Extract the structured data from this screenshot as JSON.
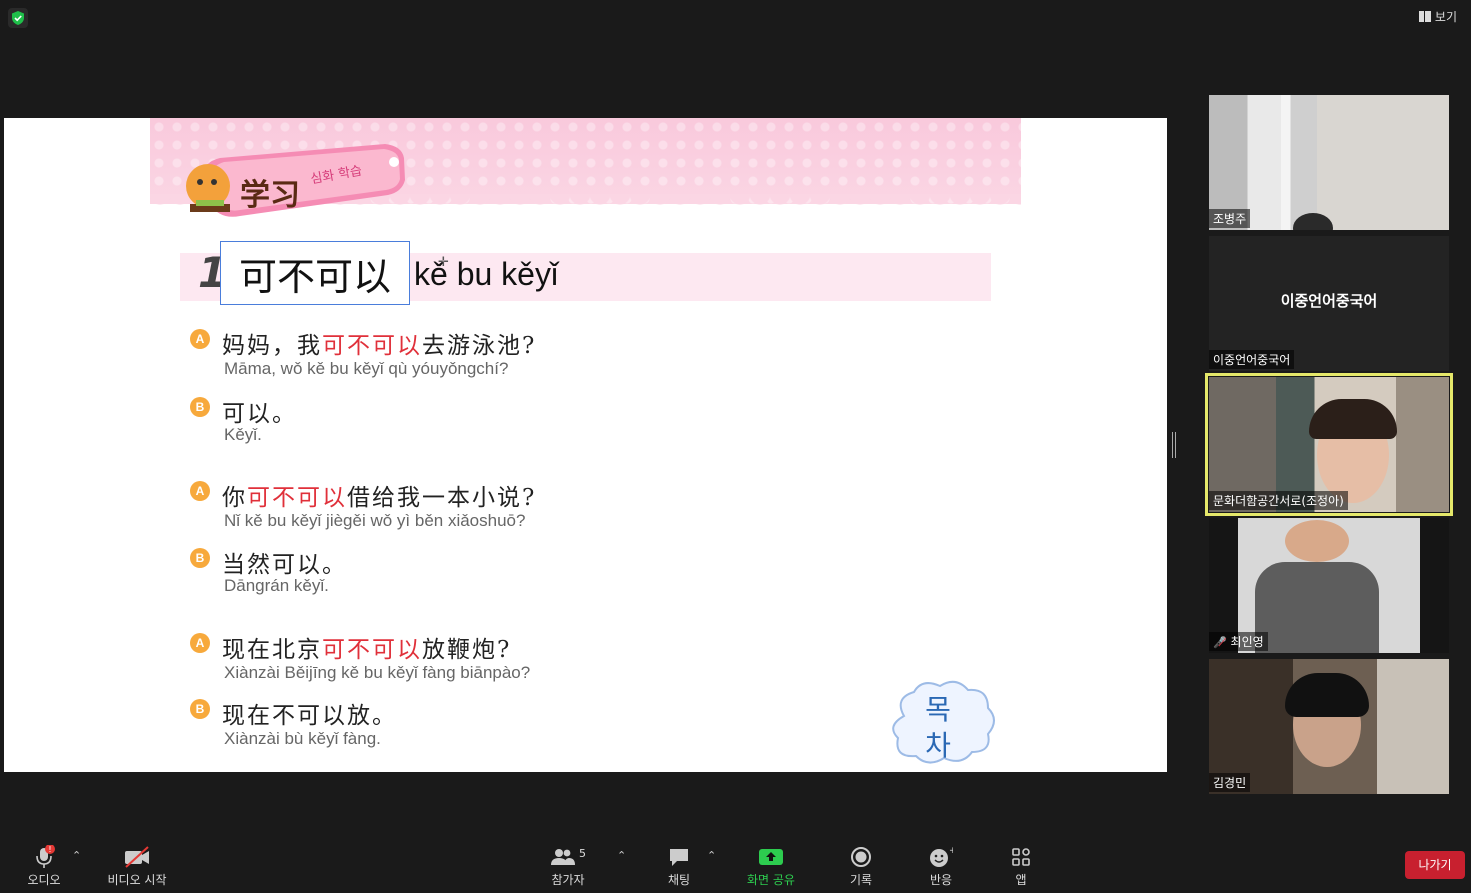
{
  "topbar": {
    "view_label": "보기"
  },
  "slide": {
    "banner_title": "学习",
    "banner_subtitle": "심화 학습",
    "lesson_number": "1",
    "lesson_phrase": "可不可以",
    "lesson_pinyin": "kě bu kěyǐ",
    "dialogs": [
      {
        "badge": "A",
        "zh_pre": "妈妈，我",
        "zh_hl": "可不可以",
        "zh_post": "去游泳池?",
        "py": "Māma, wǒ kě bu kěyǐ qù yóuyǒngchí?"
      },
      {
        "badge": "B",
        "zh_pre": "可以。",
        "zh_hl": "",
        "zh_post": "",
        "py": "Kěyǐ."
      },
      {
        "badge": "A",
        "zh_pre": "你",
        "zh_hl": "可不可以",
        "zh_post": "借给我一本小说?",
        "py": "Nǐ kě bu kěyǐ jiègěi wǒ yì běn xiǎoshuō?"
      },
      {
        "badge": "B",
        "zh_pre": "当然可以。",
        "zh_hl": "",
        "zh_post": "",
        "py": "Dāngrán kěyǐ."
      },
      {
        "badge": "A",
        "zh_pre": "现在北京",
        "zh_hl": "可不可以",
        "zh_post": "放鞭炮?",
        "py": "Xiànzài Běijīng kě bu kěyǐ fàng biānpào?"
      },
      {
        "badge": "B",
        "zh_pre": "现在不可以放。",
        "zh_hl": "",
        "zh_post": "",
        "py": "Xiànzài bù kěyǐ fàng."
      }
    ],
    "toc_label": "목차"
  },
  "participants": [
    {
      "name": "조병주"
    },
    {
      "name": "이중언어중국어",
      "center_name": "이중언어중국어"
    },
    {
      "name": "문화더함공간서로(조정아)"
    },
    {
      "name": "최인영"
    },
    {
      "name": "김경민"
    }
  ],
  "toolbar": {
    "audio": "오디오",
    "video": "비디오 시작",
    "participants": "참가자",
    "participants_count": "5",
    "chat": "채팅",
    "share": "화면 공유",
    "record": "기록",
    "reactions": "반응",
    "apps": "앱",
    "leave": "나가기"
  },
  "colors": {
    "share_green": "#2dcc4f",
    "leave_red": "#c8202f",
    "highlight_red": "#e0303a",
    "active_speaker": "#e5e86a"
  }
}
